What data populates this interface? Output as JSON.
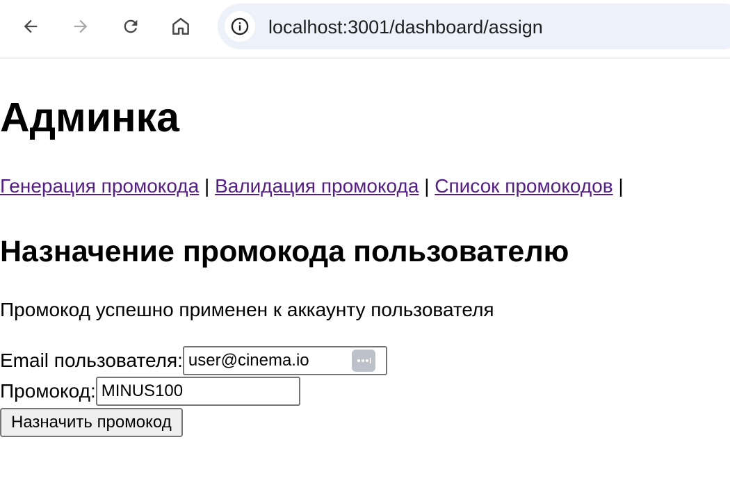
{
  "browser": {
    "url": "localhost:3001/dashboard/assign",
    "icons": [
      "back-arrow-icon",
      "forward-arrow-icon",
      "reload-icon",
      "home-icon",
      "site-info-icon"
    ]
  },
  "page": {
    "title": "Админка",
    "nav": {
      "links": [
        {
          "label": "Генерация промокода"
        },
        {
          "label": "Валидация промокода"
        },
        {
          "label": "Список промокодов"
        }
      ],
      "separator": "|"
    },
    "section_title": "Назначение промокода пользователю",
    "status_message": "Промокод успешно применен к аккаунту пользователя",
    "form": {
      "email_label": "Email пользователя:",
      "email_value": "user@cinema.io",
      "promo_label": "Промокод:",
      "promo_value": "MINUS100",
      "submit_label": "Назначить промокод"
    }
  },
  "colors": {
    "link_visited": "#551a8b",
    "omnibox_bg": "#edf2fa"
  }
}
